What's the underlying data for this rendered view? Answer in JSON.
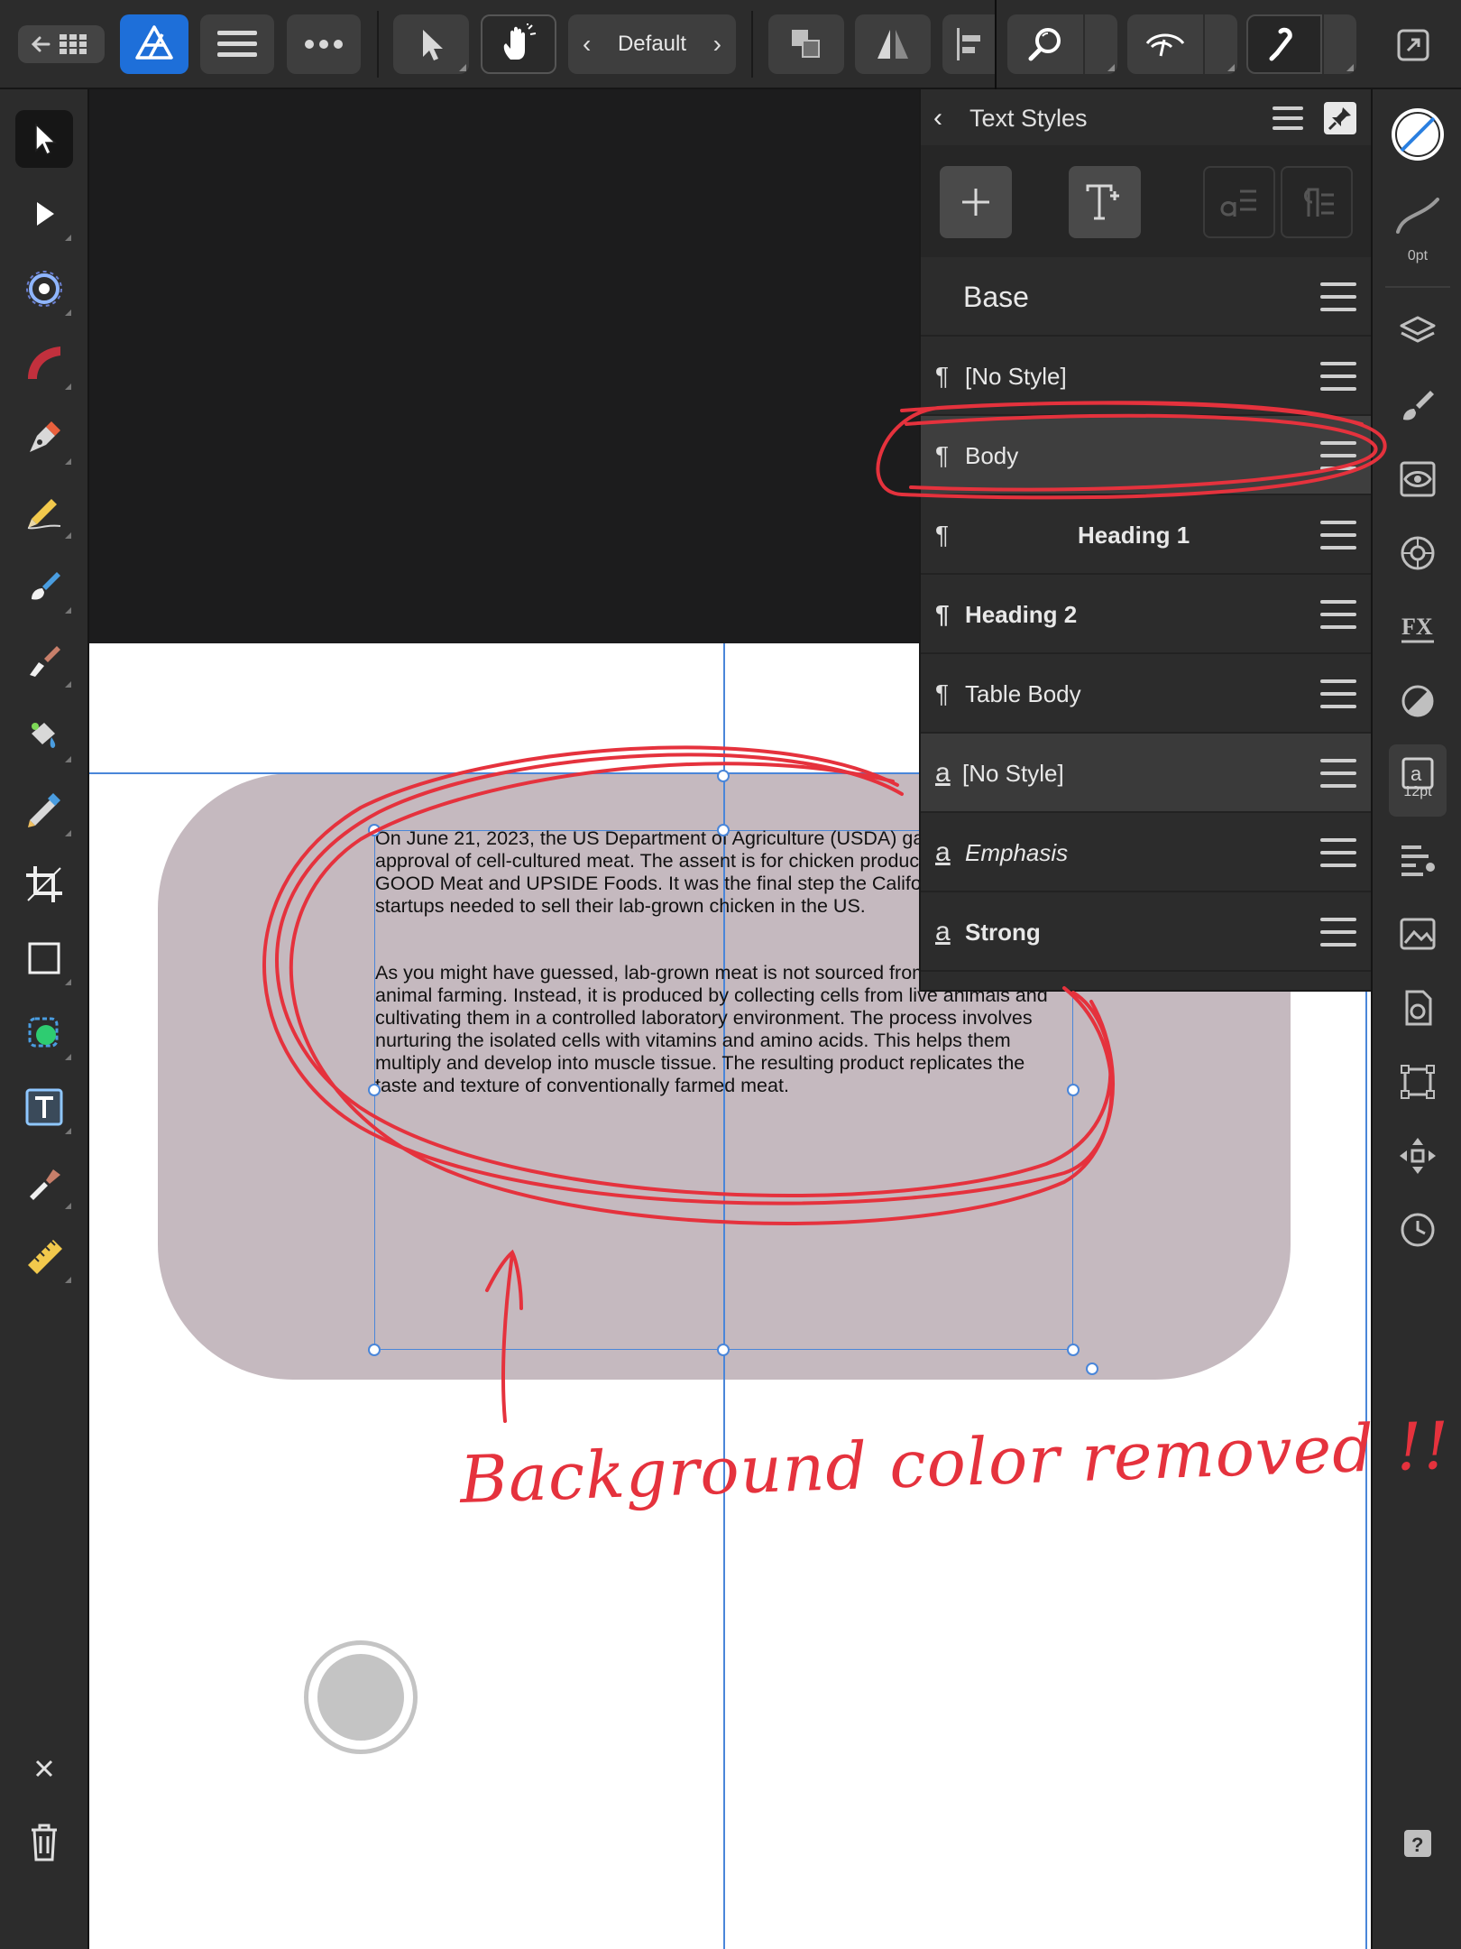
{
  "toolbar": {
    "view_mode": "Default"
  },
  "text_styles_panel": {
    "title": "Text Styles",
    "group_label": "Base",
    "paragraph_styles": [
      {
        "icon": "¶",
        "label": "[No Style]"
      },
      {
        "icon": "¶",
        "label": "Body"
      },
      {
        "icon": "¶",
        "label": "Heading 1"
      },
      {
        "icon": "¶",
        "label": "Heading 2"
      },
      {
        "icon": "¶",
        "label": "Table Body"
      }
    ],
    "character_styles": [
      {
        "icon": "a",
        "label": "[No Style]"
      },
      {
        "icon": "a",
        "label": "Emphasis"
      },
      {
        "icon": "a",
        "label": "Strong"
      }
    ]
  },
  "studio": {
    "stroke_width_label": "0pt",
    "text_size_label": "12pt"
  },
  "document": {
    "paragraphs": [
      "On June 21, 2023, the US Department of Agriculture (USDA) gave its first-ever approval of cell-cultured meat. The assent is for chicken products made by GOOD Meat and UPSIDE Foods. It was the final step the California-based startups needed to sell their lab-grown chicken in the US.",
      "As you might have guessed, lab-grown meat is not sourced from traditional animal farming. Instead, it is produced by collecting cells from live animals and cultivating them in a controlled laboratory environment. The process involves nurturing the isolated cells with vitamins and amino acids. This helps them multiply and develop into muscle tissue. The resulting product replicates the taste and texture of conventionally farmed meat."
    ]
  },
  "annotation": {
    "text": "Background color removed !!",
    "color": "#e5323d"
  },
  "colors": {
    "ui_dark": "#2c2c2c",
    "selection_blue": "#4a86d9",
    "shape_fill": "#c5b9bf",
    "app_icon_blue": "#1e6fd9"
  }
}
